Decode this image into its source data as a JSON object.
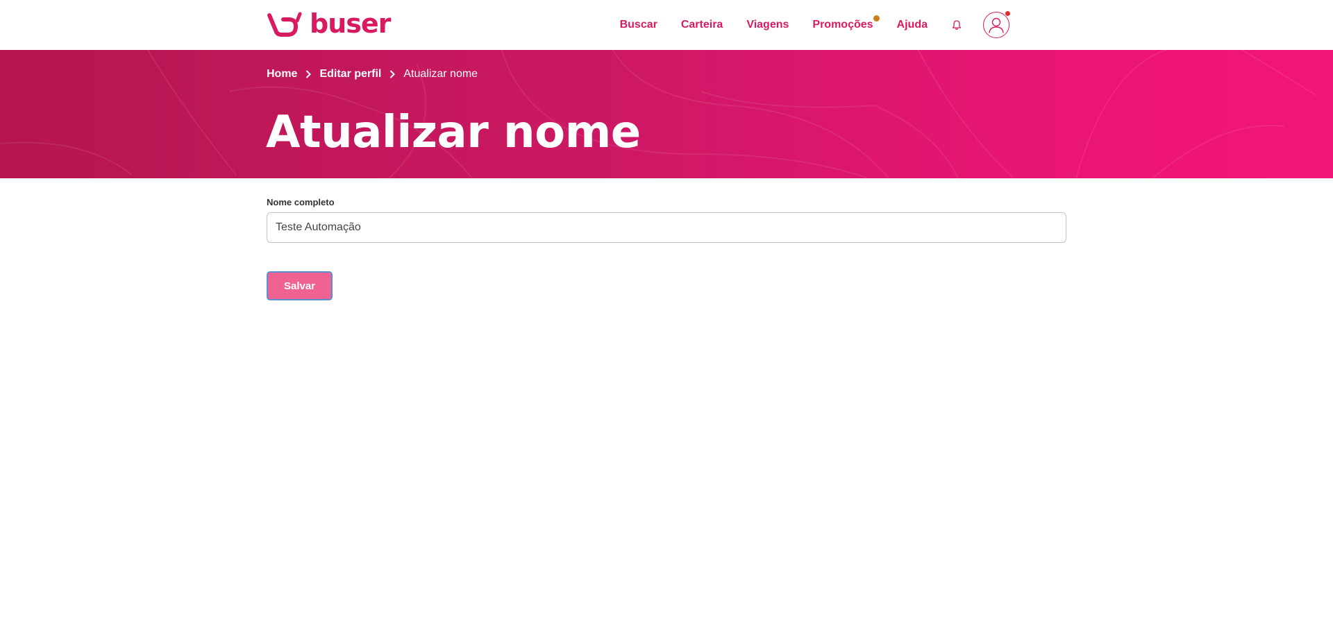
{
  "brand": {
    "name": "buser",
    "color": "#d81b60"
  },
  "nav": {
    "items": [
      {
        "label": "Buscar"
      },
      {
        "label": "Carteira"
      },
      {
        "label": "Viagens"
      },
      {
        "label": "Promoções",
        "has_dot": true
      },
      {
        "label": "Ajuda"
      }
    ],
    "bell_icon": "bell-icon",
    "avatar_icon": "user-avatar-icon"
  },
  "breadcrumb": {
    "items": [
      {
        "label": "Home"
      },
      {
        "label": "Editar perfil"
      }
    ],
    "current": "Atualizar nome"
  },
  "page": {
    "title": "Atualizar nome"
  },
  "form": {
    "name_label": "Nome completo",
    "name_value": "Teste Automação",
    "save_label": "Salvar"
  },
  "colors": {
    "accent": "#d81b60",
    "banner_start": "#b5164f",
    "banner_end": "#f3157a",
    "save_button": "#f06292",
    "promo_dot": "#c97f1d",
    "avatar_dot": "#e02b2b"
  }
}
